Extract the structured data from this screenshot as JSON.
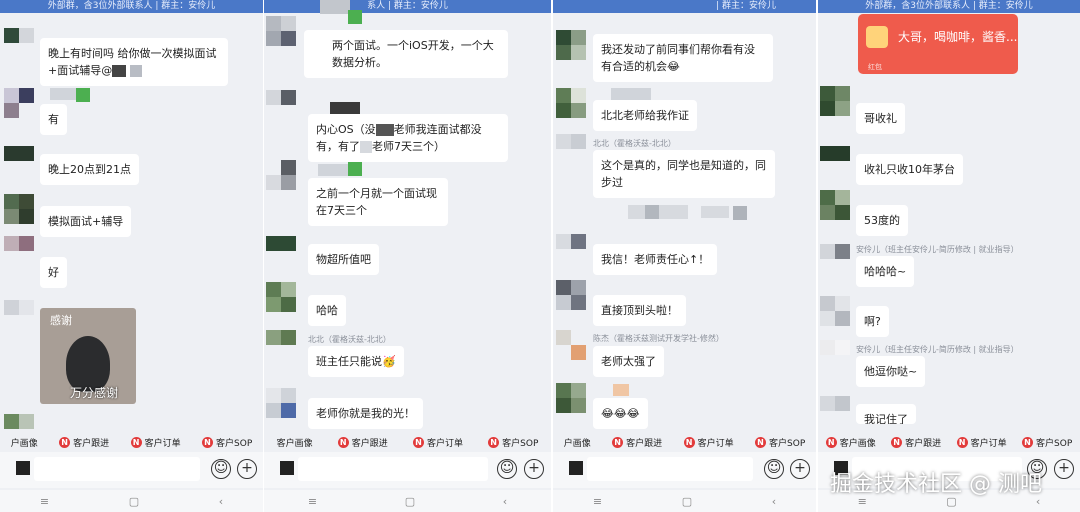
{
  "panels": [
    {
      "topbar": "外部群，含3位外部联系人 | 群主：安伶儿",
      "messages": [
        {
          "text": "晚上有时间吗 给你做一次模拟面试+面试辅导@"
        },
        {
          "text": "有"
        },
        {
          "text": "晚上20点到21点"
        },
        {
          "text": "模拟面试+辅导"
        },
        {
          "text": "好"
        }
      ],
      "sticker": {
        "top": "感谢",
        "bottom": "万分感谢"
      }
    },
    {
      "topbar": "系人 | 群主：安伶儿",
      "messages": [
        {
          "text": "两个面试。一个iOS开发，一个大数据分析。"
        },
        {
          "text_a": "内心OS（没",
          "text_b": "老师我连面试都没有，有了",
          "text_c": "老师7天三个）"
        },
        {
          "text": "之前一个月就一个面试现在7天三个"
        },
        {
          "text": "物超所值吧"
        },
        {
          "text": "哈哈"
        },
        {
          "sender": "北北（霍格沃兹-北北）",
          "text": "班主任只能说🥳"
        },
        {
          "text": "老师你就是我的光！"
        }
      ]
    },
    {
      "topbar": "| 群主：安伶儿",
      "messages": [
        {
          "text": "我还发动了前同事们帮你看有没有合适的机会😂"
        },
        {
          "text": "北北老师给我作证"
        },
        {
          "sender": "北北（霍格沃兹-北北）",
          "text": "这个是真的，同学也是知道的，同步过"
        },
        {
          "text": "我信！老师责任心↑！"
        },
        {
          "text": "直接顶到头啦！"
        },
        {
          "sender": "陈杰（霍格沃兹测试开发学社-修然）",
          "text": "老师太强了"
        },
        {
          "text": "😂😂😂"
        }
      ]
    },
    {
      "topbar": "外部群，含3位外部联系人 | 群主：安伶儿",
      "redcard": {
        "text": "大哥，喝咖啡，酱香...",
        "footer": "红包"
      },
      "messages": [
        {
          "text": "哥收礼"
        },
        {
          "text": "收礼只收10年茅台"
        },
        {
          "text": "53度的"
        },
        {
          "sender": "安伶儿（班主任安伶儿-简历修改 | 就业指导）",
          "text": "哈哈哈~"
        },
        {
          "text": "啊?"
        },
        {
          "sender": "安伶儿（班主任安伶儿-简历修改 | 就业指导）",
          "text": "他逗你哒~"
        },
        {
          "text": "我记住了"
        }
      ]
    }
  ],
  "shortcuts": {
    "p1": [
      "户画像",
      "客户跟进",
      "客户订单",
      "客户SOP"
    ],
    "p2": [
      "客户画像",
      "客户跟进",
      "客户订单",
      "客户SOP"
    ],
    "p3": [
      "户画像",
      "客户跟进",
      "客户订单",
      "客户SOP"
    ],
    "p4": [
      "客户画像",
      "客户跟进",
      "客户订单",
      "客户SOP"
    ]
  },
  "icons": {
    "emoji": "☺",
    "plus": "+",
    "nav_menu": "≡",
    "nav_home": "▢",
    "nav_back": "‹",
    "shortcut": "N"
  },
  "watermark": "掘金技术社区 @ 测吧",
  "colors": {
    "topbar": "#4a78c8",
    "redpacket": "#ef5b4c",
    "shortcut_icon": "#e23b3b"
  }
}
